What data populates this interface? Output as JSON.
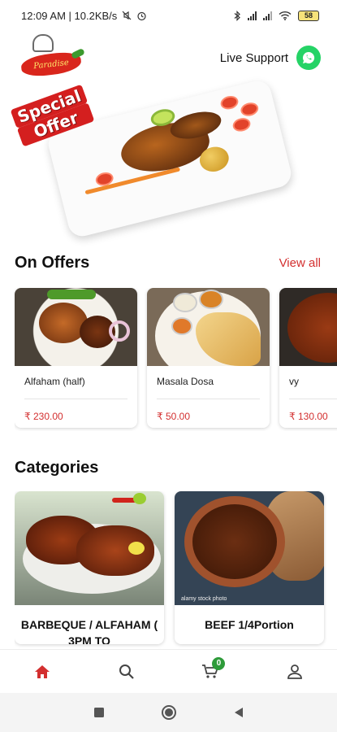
{
  "status_bar": {
    "time_and_speed": "12:09 AM | 10.2KB/s",
    "battery": "58",
    "icons": [
      "mute-icon",
      "alarm-icon",
      "bluetooth-icon",
      "signal-icon",
      "signal-icon",
      "wifi-icon",
      "battery-icon"
    ]
  },
  "header": {
    "logo_text": "Paradise",
    "support_label": "Live Support",
    "support_icon": "whatsapp-icon"
  },
  "hero": {
    "badge_line1": "Special",
    "badge_line2": "Offer"
  },
  "offers": {
    "title": "On Offers",
    "view_all": "View all",
    "items": [
      {
        "name": "Alfaham (half)",
        "price": "₹ 230.00"
      },
      {
        "name": "Masala Dosa",
        "price": "₹ 50.00"
      },
      {
        "name": "vy",
        "price": "₹ 130.00"
      }
    ]
  },
  "categories": {
    "title": "Categories",
    "items": [
      {
        "label": "BARBEQUE / ALFAHAM ( 3PM TO"
      },
      {
        "label": "BEEF 1/4Portion",
        "watermark": "alamy stock photo"
      }
    ]
  },
  "bottom_nav": {
    "items": [
      "home-icon",
      "search-icon",
      "cart-icon",
      "profile-icon"
    ],
    "cart_count": "0",
    "active_color": "#d32f2f"
  },
  "colors": {
    "accent": "#d32f2f",
    "whatsapp": "#25d366",
    "badge": "#2e9b3a"
  }
}
